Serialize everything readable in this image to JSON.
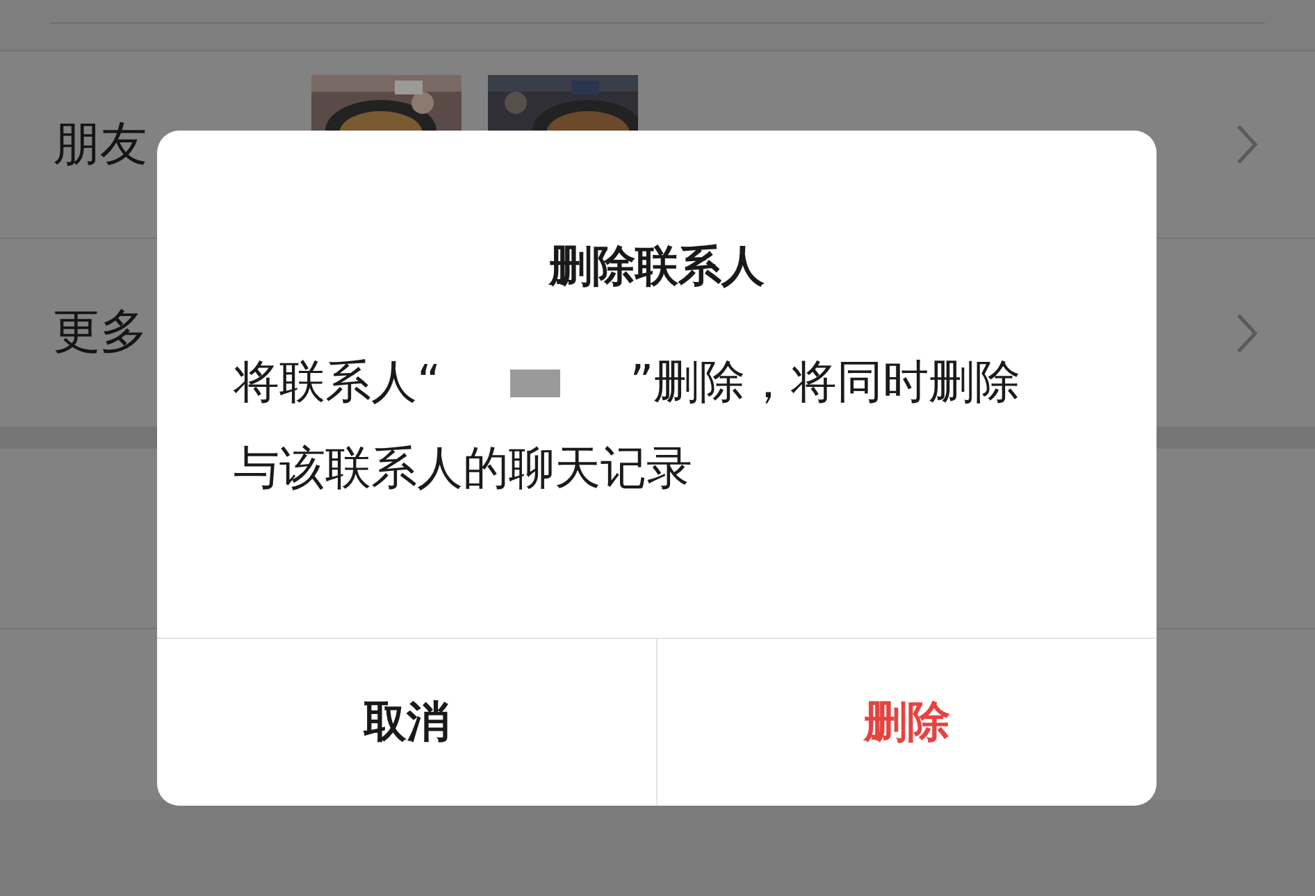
{
  "background_list": {
    "rows": [
      {
        "label": "朋友",
        "kind": "photos"
      },
      {
        "label": "更多",
        "kind": "plain"
      }
    ]
  },
  "dialog": {
    "title": "删除联系人",
    "message_before": "将联系人“",
    "message_after": "”删除，将同时删除与该联系人的聊天记录",
    "name_redacted": true,
    "buttons": [
      {
        "label": "取消",
        "kind": "cancel"
      },
      {
        "label": "删除",
        "kind": "destructive"
      }
    ]
  }
}
